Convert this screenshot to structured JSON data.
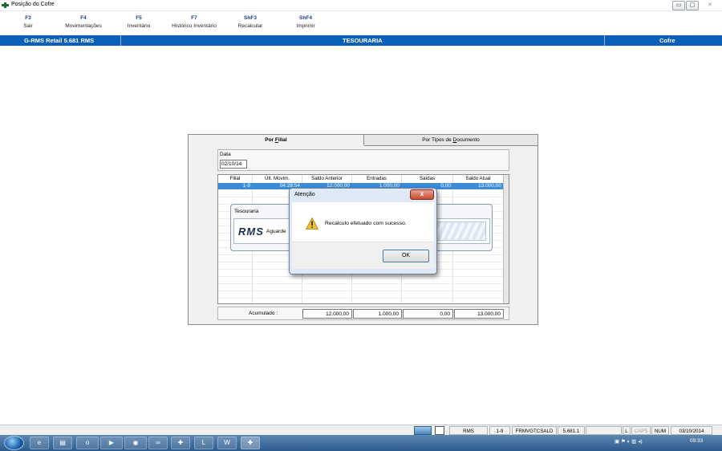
{
  "window": {
    "title": "Posição do Cofre",
    "controls": [
      "▭",
      "▢",
      "✕"
    ]
  },
  "toolbar": [
    {
      "key": "F3",
      "label": "Sair"
    },
    {
      "key": "F4",
      "label": "Movimentações"
    },
    {
      "key": "F5",
      "label": "Inventário"
    },
    {
      "key": "F7",
      "label": "Histórico Inventário"
    },
    {
      "key": "ShF3",
      "label": "Recalcular"
    },
    {
      "key": "ShF4",
      "label": "Imprimir"
    }
  ],
  "header_strip": {
    "app": "G-RMS Retail 5.681 RMS",
    "section": "TESOURARIA",
    "module": "Cofre"
  },
  "tabs": [
    {
      "label": "Por Filial",
      "underline": "F",
      "active": true
    },
    {
      "label": "Por Tipos de Documento",
      "underline": "D",
      "active": false
    }
  ],
  "date": {
    "label": "Data",
    "value": "02/10/14"
  },
  "grid": {
    "columns": [
      "Filial",
      "Últ. Movim.",
      "Saldo Anterior",
      "Entradas",
      "Saídas",
      "Saldo Atual"
    ],
    "rows": [
      {
        "filial": "1-9",
        "ult_movim": "04:28:54",
        "saldo_anterior": "12.000,00",
        "entradas": "1.000,00",
        "saidas": "0,00",
        "saldo_atual": "13.000,00"
      }
    ]
  },
  "accumulated": {
    "label": "Acumulado :",
    "saldo_anterior": "12.000,00",
    "entradas": "1.000,00",
    "saidas": "0,00",
    "saldo_atual": "13.000,00"
  },
  "tesouraria_popup": {
    "title": "Tesouraria",
    "logo": "RMS",
    "message": "Aguarde"
  },
  "dialog": {
    "title": "Atenção",
    "message": "Recalculo efetuado com sucesso.",
    "ok_label": "OK",
    "close_label": "x"
  },
  "status_bar": {
    "user": "RMS",
    "filial": "1-9",
    "form": "FRMVGTCSALD",
    "version": "5.681.1",
    "l": "L",
    "caps": "CAPS",
    "num": "NUM",
    "date": "03/10/2014"
  },
  "taskbar": {
    "time": "09:33"
  }
}
